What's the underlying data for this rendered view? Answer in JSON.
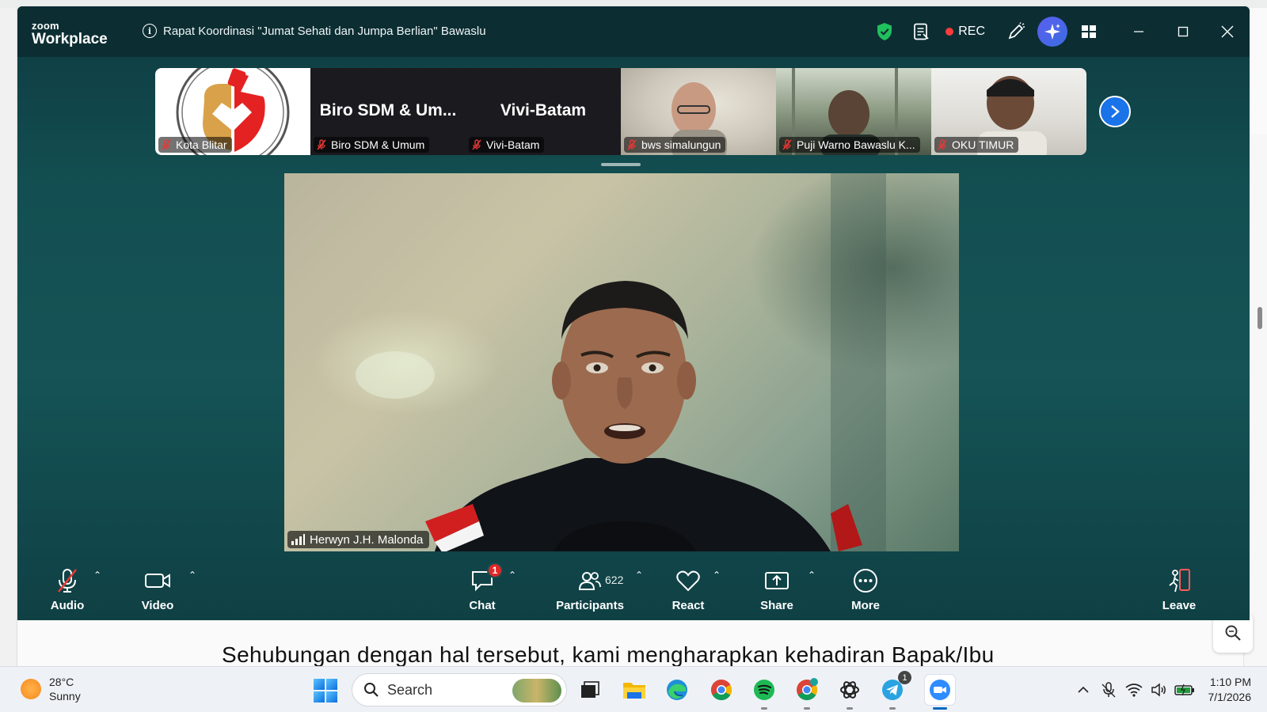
{
  "window": {
    "brand_top": "zoom",
    "brand_bottom": "Workplace",
    "meeting_title": "Rapat Koordinasi \"Jumat Sehati dan Jumpa Berlian\" Bawaslu",
    "rec_label": "REC"
  },
  "gallery": {
    "tiles": [
      {
        "name": "Kota Blitar",
        "display": ""
      },
      {
        "name": "Biro SDM & Umum",
        "display": "Biro SDM & Um..."
      },
      {
        "name": "Vivi-Batam",
        "display": "Vivi-Batam"
      },
      {
        "name": "bws simalungun",
        "display": ""
      },
      {
        "name": "Puji Warno Bawaslu K...",
        "display": ""
      },
      {
        "name": "OKU TIMUR",
        "display": ""
      }
    ]
  },
  "speaker": {
    "name": "Herwyn J.H. Malonda"
  },
  "toolbar": {
    "audio": "Audio",
    "video": "Video",
    "chat": "Chat",
    "chat_badge": "1",
    "participants": "Participants",
    "participants_count": "622",
    "react": "React",
    "share": "Share",
    "more": "More",
    "leave": "Leave"
  },
  "background_doc": {
    "line": "Sehubungan dengan hal tersebut, kami mengharapkan kehadiran Bapak/Ibu"
  },
  "taskbar": {
    "temperature": "28°C",
    "condition": "Sunny",
    "search_placeholder": "Search",
    "time": "1:10 PM",
    "date": "7/1/2026",
    "telegram_badge": "1"
  },
  "colors": {
    "window_bg": "#134f52",
    "titlebar": "#0c2e33",
    "accent_blue": "#1a73e8",
    "muted_red": "#e53935",
    "shield_green": "#20c05c"
  }
}
